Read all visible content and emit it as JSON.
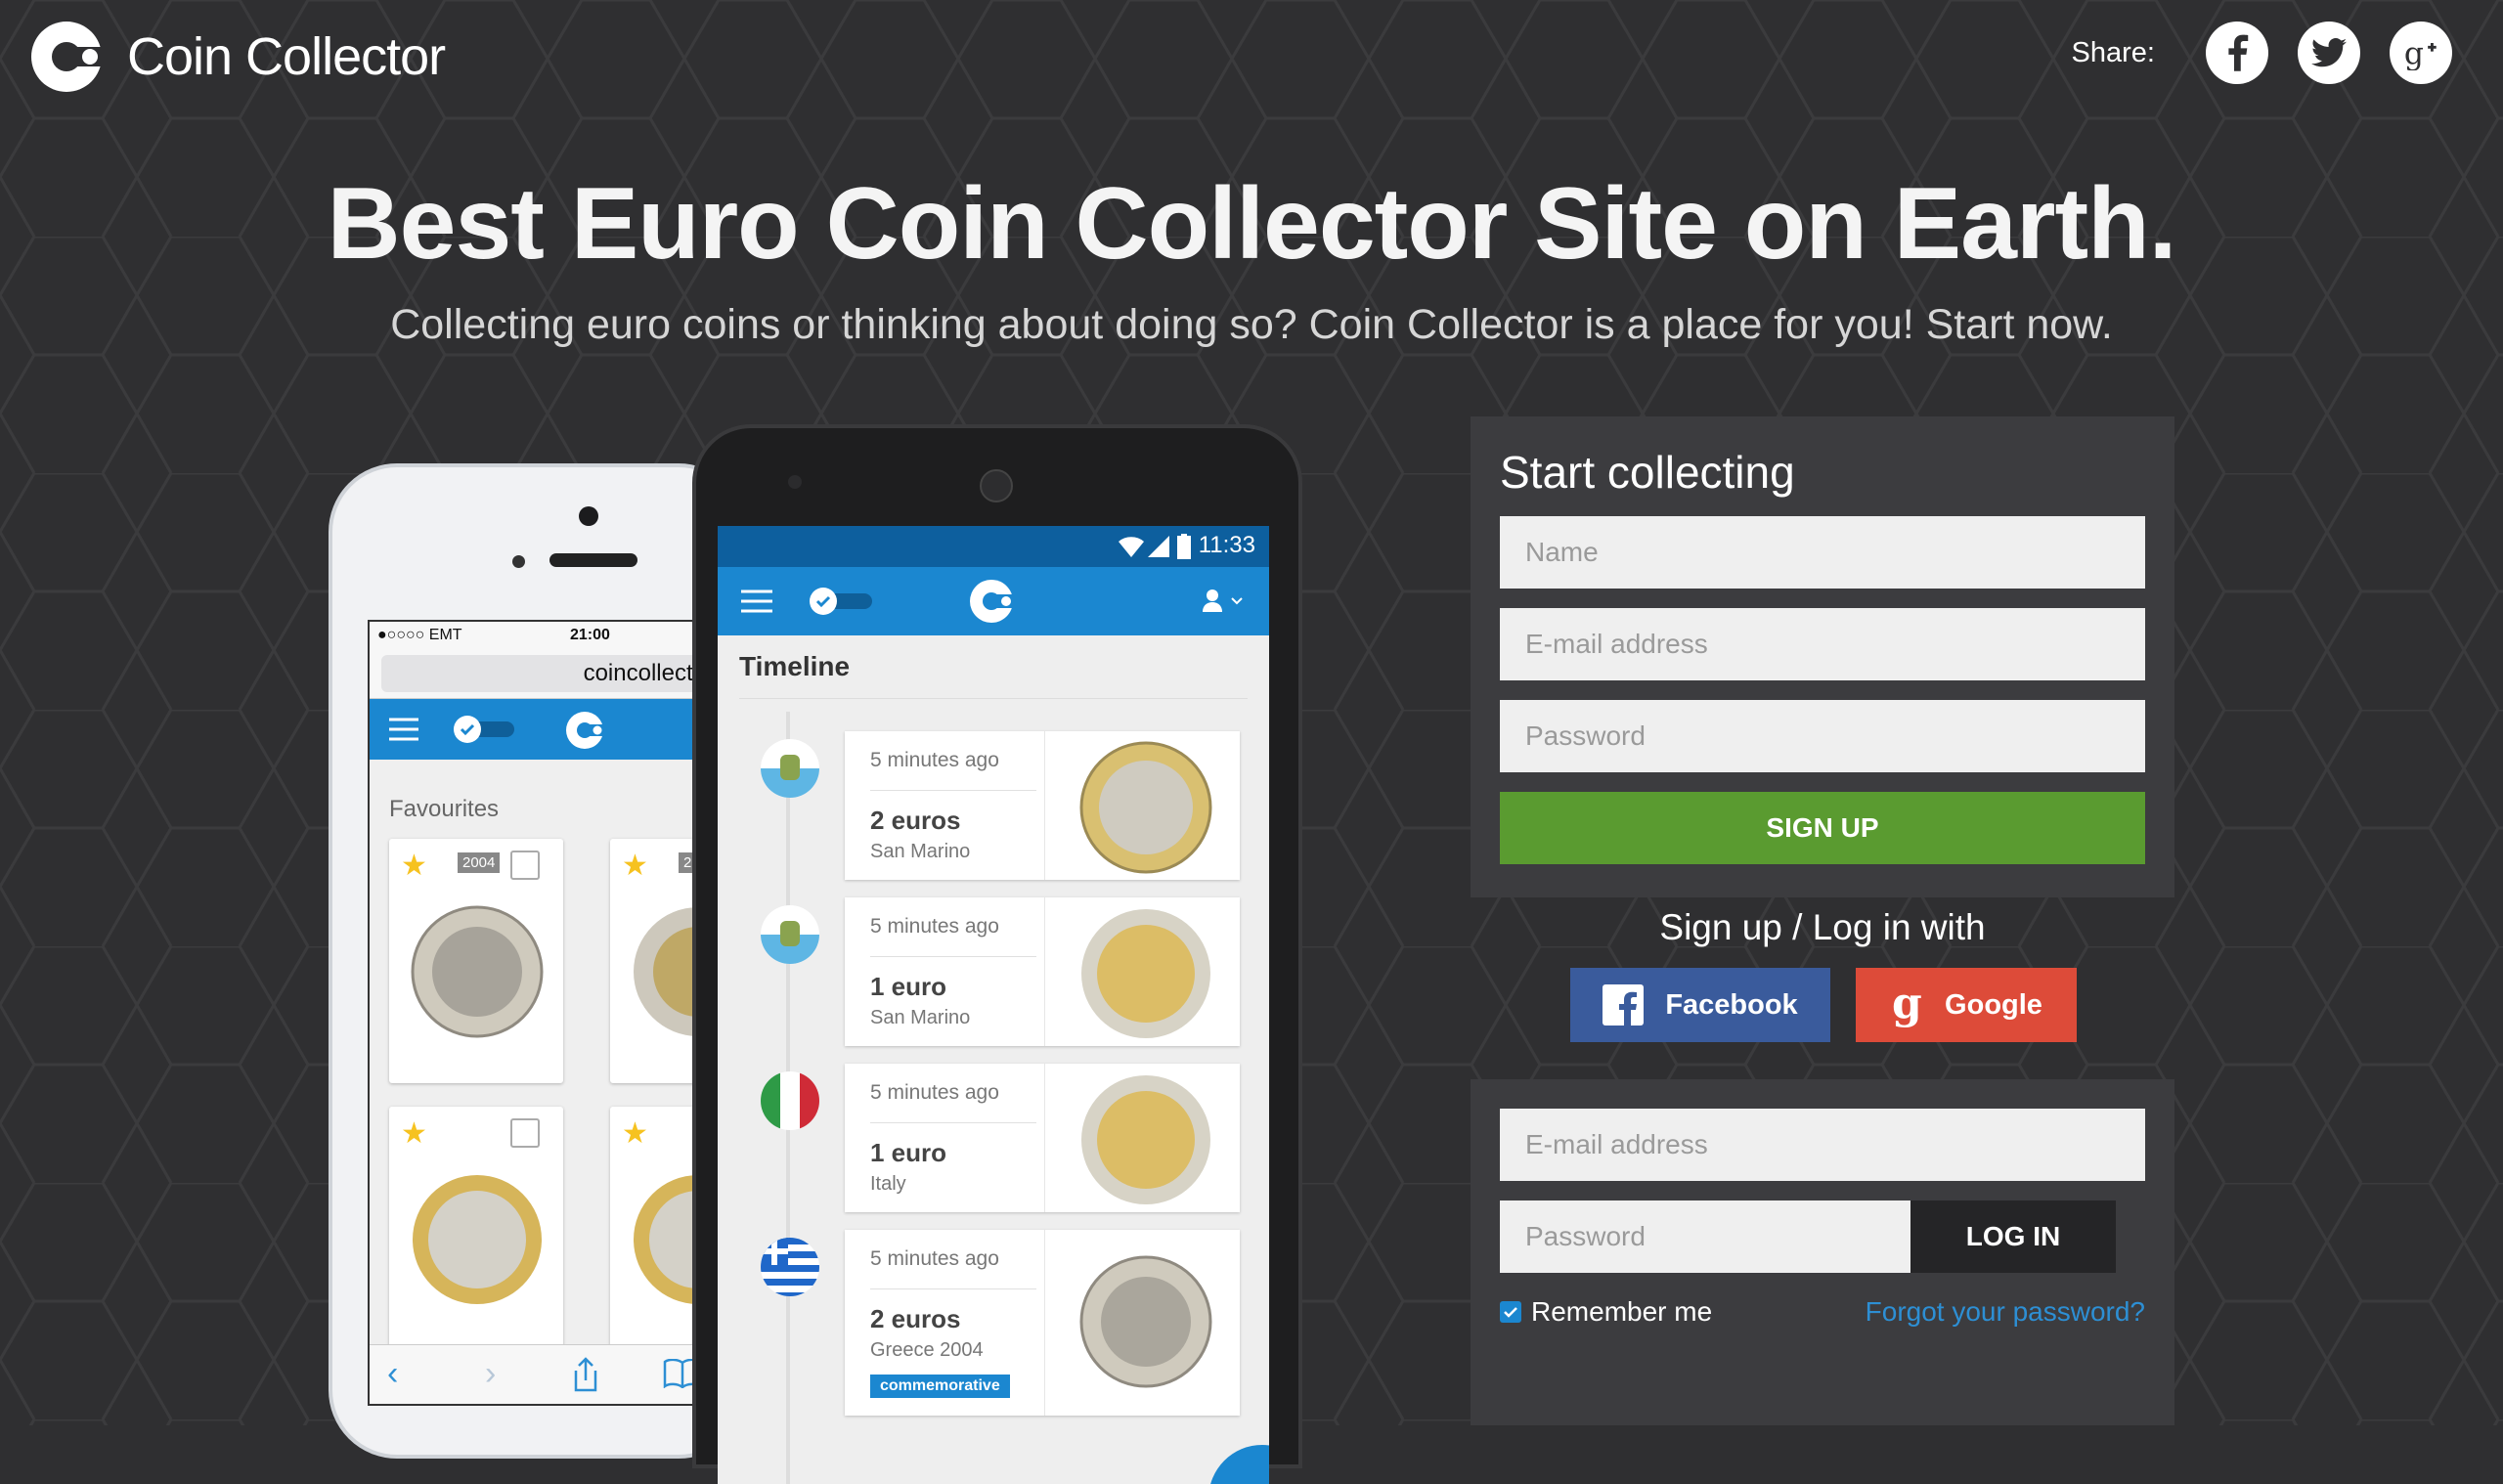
{
  "header": {
    "brand": "Coin Collector",
    "share_label": "Share:",
    "share_icons": [
      "facebook-icon",
      "twitter-icon",
      "google-plus-icon"
    ]
  },
  "hero": {
    "title": "Best Euro Coin Collector Site on Earth.",
    "subtitle": "Collecting euro coins or thinking about doing so? Coin Collector is a place for you! Start now."
  },
  "iphone": {
    "carrier": "●○○○○ EMT",
    "time": "21:00",
    "url": "coincollector.eu",
    "section": "Favourites",
    "years": [
      "2004",
      "20"
    ]
  },
  "android": {
    "time": "11:33",
    "section": "Timeline",
    "entries": [
      {
        "time": "5 minutes ago",
        "value": "2 euros",
        "country": "San Marino",
        "badge": ""
      },
      {
        "time": "5 minutes ago",
        "value": "1 euro",
        "country": "San Marino",
        "badge": ""
      },
      {
        "time": "5 minutes ago",
        "value": "1 euro",
        "country": "Italy",
        "badge": ""
      },
      {
        "time": "5 minutes ago",
        "value": "2 euros",
        "country": "Greece 2004",
        "badge": "commemorative"
      }
    ]
  },
  "signup": {
    "title": "Start collecting",
    "name_placeholder": "Name",
    "email_placeholder": "E-mail address",
    "password_placeholder": "Password",
    "button": "SIGN UP"
  },
  "social": {
    "label": "Sign up / Log in with",
    "facebook": "Facebook",
    "google": "Google"
  },
  "login": {
    "email_placeholder": "E-mail address",
    "password_placeholder": "Password",
    "button": "LOG IN",
    "remember": "Remember me",
    "forgot": "Forgot your password?"
  },
  "colors": {
    "background": "#2f2f31",
    "panel": "#3c3c3f",
    "app_blue": "#1b87d0",
    "signup_green": "#5a9b30",
    "facebook_blue": "#3a5b9c",
    "google_red": "#dd4b39",
    "link_blue": "#2d8fd4"
  }
}
